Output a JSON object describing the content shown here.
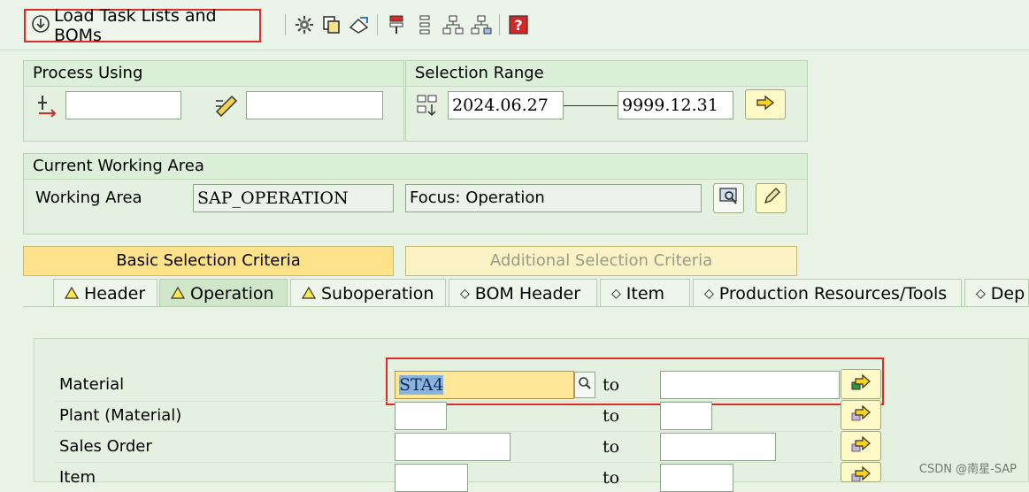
{
  "toolbar": {
    "load_label": "Load Task Lists and BOMs",
    "icons": [
      "settings-icon",
      "copy-icon",
      "refresh-icon",
      "column-icon",
      "tree-icon",
      "hierarchy-icon",
      "hierarchy-alt-icon",
      "help-icon"
    ]
  },
  "process_using": {
    "title": "Process Using",
    "field1": "",
    "field2": ""
  },
  "selection_range": {
    "title": "Selection Range",
    "from": "2024.06.27",
    "to": "9999.12.31"
  },
  "working_area": {
    "title": "Current Working Area",
    "label": "Working Area",
    "value": "SAP_OPERATION",
    "focus": "Focus: Operation"
  },
  "criteria": {
    "basic": "Basic Selection Criteria",
    "additional": "Additional Selection Criteria"
  },
  "tabs": [
    {
      "label": "Header",
      "marker": "△"
    },
    {
      "label": "Operation",
      "marker": "△"
    },
    {
      "label": "Suboperation",
      "marker": "△"
    },
    {
      "label": "BOM Header",
      "marker": "◇"
    },
    {
      "label": "Item",
      "marker": "◇"
    },
    {
      "label": "Production Resources/Tools",
      "marker": "◇"
    },
    {
      "label": "Dep",
      "marker": "◇"
    }
  ],
  "selection_rows": [
    {
      "label": "Material",
      "from": "STA4",
      "to_label": "to",
      "to": ""
    },
    {
      "label": "Plant (Material)",
      "from": "",
      "to_label": "to",
      "to": ""
    },
    {
      "label": "Sales Order",
      "from": "",
      "to_label": "to",
      "to": ""
    },
    {
      "label": "Item",
      "from": "",
      "to_label": "to",
      "to": ""
    }
  ],
  "watermark": "CSDN @南星-SAP",
  "colors": {
    "background": "#e8f3e6",
    "highlight": "#e02a2a",
    "button_yellow": "#fff2a8",
    "selected_field": "#ffe79a"
  }
}
